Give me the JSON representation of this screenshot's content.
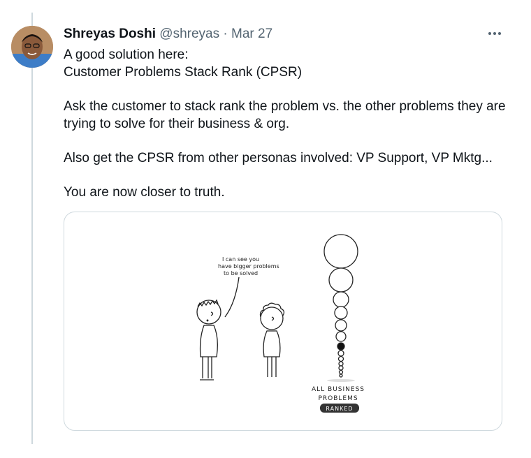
{
  "tweet": {
    "author_name": "Shreyas Doshi",
    "author_handle": "@shreyas",
    "separator": "·",
    "date": "Mar 27",
    "lines": [
      "A good solution here:",
      "Customer Problems Stack Rank (CPSR)",
      "",
      "Ask the customer to stack rank the problem vs. the other problems they are trying to solve for their business & org.",
      "",
      "Also get the CPSR from other personas involved: VP Support, VP Mktg...",
      "",
      "You are now closer to truth."
    ],
    "more_icon": "ellipsis-icon"
  },
  "illustration": {
    "speech_line1": "I can see you",
    "speech_line2": "have bigger problems",
    "speech_line3": "to be solved",
    "caption_line1": "ALL BUSINESS",
    "caption_line2": "PROBLEMS",
    "badge": "RANKED"
  },
  "colors": {
    "text": "#0f1419",
    "secondary": "#536471",
    "border": "#cfd9de"
  }
}
